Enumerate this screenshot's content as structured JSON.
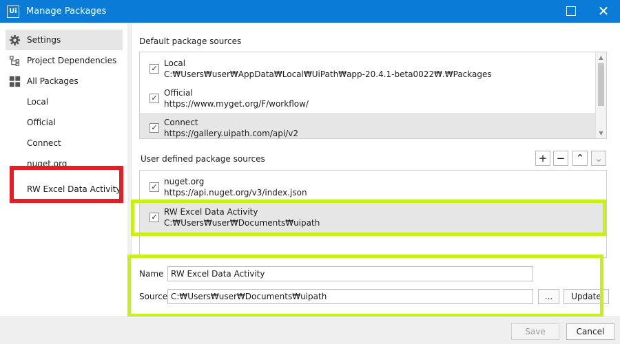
{
  "window": {
    "logo_text": "Ui",
    "title": "Manage Packages",
    "close_glyph": "✕"
  },
  "sidebar": {
    "items": [
      {
        "label": "Settings",
        "icon": "gear-icon"
      },
      {
        "label": "Project Dependencies",
        "icon": "tree-icon"
      },
      {
        "label": "All Packages",
        "icon": "grid-icon"
      },
      {
        "label": "Local"
      },
      {
        "label": "Official"
      },
      {
        "label": "Connect"
      },
      {
        "label": "nuget.org"
      },
      {
        "label": "RW Excel Data Activity"
      }
    ]
  },
  "default_sources": {
    "heading": "Default package sources",
    "items": [
      {
        "name": "Local",
        "path": "C:₩Users₩user₩AppData₩Local₩UiPath₩app-20.4.1-beta0022₩.₩Packages",
        "checked": true
      },
      {
        "name": "Official",
        "path": "https://www.myget.org/F/workflow/",
        "checked": true
      },
      {
        "name": "Connect",
        "path": "https://gallery.uipath.com/api/v2",
        "checked": true
      }
    ]
  },
  "user_sources": {
    "heading": "User defined package sources",
    "items": [
      {
        "name": "nuget.org",
        "path": "https://api.nuget.org/v3/index.json",
        "checked": true
      },
      {
        "name": "RW Excel Data Activity",
        "path": "C:₩Users₩user₩Documents₩uipath",
        "checked": true
      }
    ],
    "toolbar": {
      "add": "+",
      "remove": "−",
      "up": "⌃",
      "down": "⌄"
    }
  },
  "form": {
    "name_label": "Name",
    "name_value": "RW Excel Data Activity",
    "source_label": "Source",
    "source_value": "C:₩Users₩user₩Documents₩uipath",
    "browse_label": "...",
    "update_label": "Update"
  },
  "footer": {
    "save_label": "Save",
    "cancel_label": "Cancel"
  },
  "check_glyph": "✓",
  "colors": {
    "titlebar": "#0a7cd8",
    "highlight_red": "#e51d24",
    "highlight_green": "#c6f017"
  }
}
